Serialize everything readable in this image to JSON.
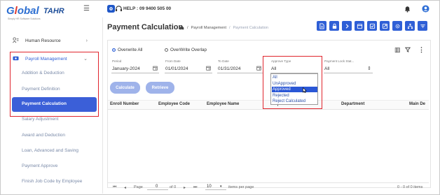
{
  "app": {
    "brand_main": "Global",
    "brand_sub": "TAHR",
    "tagline": "Simply HR Software Solutions"
  },
  "topbar": {
    "help": "HELP : 09 9400 505 00"
  },
  "sidebar": {
    "items": [
      {
        "label": "Human Resource"
      },
      {
        "label": "Payroll Management"
      }
    ],
    "subitems": [
      {
        "label": "Addition & Deduction"
      },
      {
        "label": "Payment Definition"
      },
      {
        "label": "Payment Calculation"
      },
      {
        "label": "Salary Adjustment"
      },
      {
        "label": "Award and Deduction"
      },
      {
        "label": "Loan, Advanced and Saving"
      },
      {
        "label": "Payment Approve"
      },
      {
        "label": "Finish Job Code by Employee"
      }
    ]
  },
  "page": {
    "title": "Payment Calculation",
    "breadcrumb": [
      "Payroll Management",
      "Payment Calculation"
    ]
  },
  "options": {
    "overwrite_all": "Overwrite All",
    "overwrite_overlap": "OverWrite Overlap"
  },
  "filters": {
    "period_label": "Period",
    "period_value": "January-2024",
    "from_label": "From Date",
    "from_value": "01/01/2024",
    "to_label": "To Date",
    "to_value": "01/31/2024",
    "approve_label": "Approve Type",
    "approve_value": "All",
    "lock_label": "Payment Lock Stat...",
    "lock_value": "All"
  },
  "buttons": {
    "calculate": "Calculate",
    "retrieve": "Retrieve"
  },
  "table": {
    "headers": [
      "Enroll Number",
      "Employee Code",
      "Employee Name",
      "Department Order",
      "Department",
      "Main De"
    ]
  },
  "dropdown": {
    "options": [
      "All",
      "UnApproved",
      "Approved",
      "Rejected",
      "Reject Calculated"
    ],
    "selected": "Approved"
  },
  "pager": {
    "page_label": "Page",
    "page_value": "0",
    "of_label": "of 0",
    "per_page": "10",
    "per_page_label": "items per page",
    "summary": "0 - 0 of 0 items"
  },
  "colors": {
    "accent": "#2f5fd6",
    "highlight": "#e0252d",
    "button_disabled": "#9fb3ea"
  }
}
